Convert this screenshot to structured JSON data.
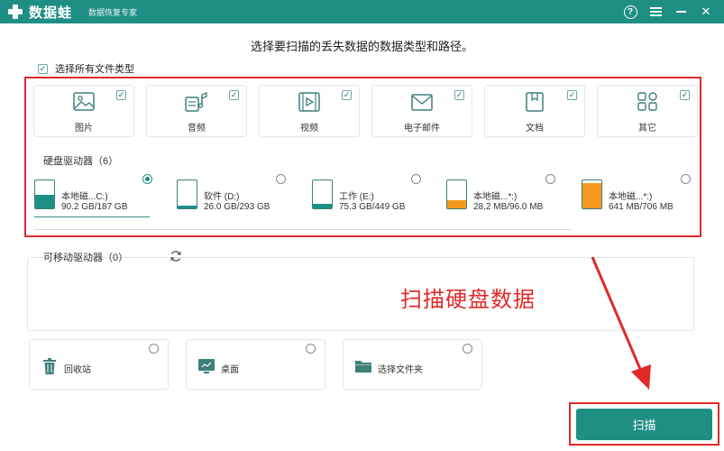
{
  "titlebar": {
    "app_name": "数据蛙",
    "subtitle": "数据恢复专家",
    "help_icon": "?",
    "menu_icon": "menu-icon",
    "minimize_icon": "minimize-icon",
    "close_icon": "✕"
  },
  "heading": "选择要扫描的丢失数据的数据类型和路径。",
  "select_all": {
    "label": "选择所有文件类型",
    "checked": true,
    "check_mark": "✓"
  },
  "file_types": [
    {
      "label": "图片",
      "icon": "image-icon",
      "checked": true
    },
    {
      "label": "音频",
      "icon": "music-icon",
      "checked": true
    },
    {
      "label": "视频",
      "icon": "video-icon",
      "checked": true
    },
    {
      "label": "电子邮件",
      "icon": "email-icon",
      "checked": true
    },
    {
      "label": "文档",
      "icon": "document-icon",
      "checked": true
    },
    {
      "label": "其它",
      "icon": "other-icon",
      "checked": true
    }
  ],
  "hard_drives": {
    "label": "硬盘驱动器（6）",
    "items": [
      {
        "name": "本地磁...C:)",
        "size": "90.2 GB/187 GB",
        "selected": true,
        "usage": 0.48,
        "fill_color": "#1f8f86",
        "icon": "windows-drive-icon"
      },
      {
        "name": "软件 (D:)",
        "size": "26.0 GB/293 GB",
        "selected": false,
        "usage": 0.09,
        "fill_color": "#1f8f86",
        "icon": "drive-icon"
      },
      {
        "name": "工作 (E:)",
        "size": "75.3 GB/449 GB",
        "selected": false,
        "usage": 0.17,
        "fill_color": "#1f8f86",
        "icon": "drive-icon"
      },
      {
        "name": "本地磁...*:)",
        "size": "28.2 MB/96.0 MB",
        "selected": false,
        "usage": 0.29,
        "fill_color": "#f39a1e",
        "icon": "drive-icon"
      },
      {
        "name": "本地磁...*:)",
        "size": "641 MB/706 MB",
        "selected": false,
        "usage": 0.91,
        "fill_color": "#f39a1e",
        "icon": "drive-icon"
      }
    ]
  },
  "removable": {
    "label": "可移动驱动器（0）",
    "refresh_icon": "refresh-icon"
  },
  "annotation": "扫描硬盘数据",
  "locations": [
    {
      "label": "回收站",
      "icon": "recycle-bin-icon",
      "selected": false
    },
    {
      "label": "桌面",
      "icon": "desktop-icon",
      "selected": false
    },
    {
      "label": "选择文件夹",
      "icon": "folder-icon",
      "selected": false
    }
  ],
  "scan_button": "扫描",
  "colors": {
    "accent": "#1f8f86",
    "highlight": "#e02a2a",
    "warning": "#f39a1e"
  }
}
